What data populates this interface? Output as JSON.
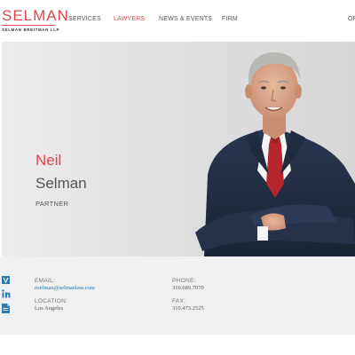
{
  "brand": {
    "name": "SELMAN",
    "subname": "SELMAN BREITMAN LLP",
    "accent_color": "#e0474c"
  },
  "nav": {
    "items": [
      {
        "label": "SERVICES",
        "active": false
      },
      {
        "label": "LAWYERS",
        "active": true
      },
      {
        "label": "NEWS & EVENTS",
        "active": false
      },
      {
        "label": "FIRM",
        "active": false
      },
      {
        "label": "OF",
        "active": false
      }
    ]
  },
  "profile": {
    "first_name": "Neil",
    "last_name": "Selman",
    "title": "PARTNER"
  },
  "contact": {
    "email_label": "EMAIL:",
    "email": "nselman@selmanlaw.com",
    "location_label": "LOCATION:",
    "location": "Los Angeles",
    "phone_label": "PHONE:",
    "phone": "310.689.7070",
    "fax_label": "FAX:",
    "fax": "310.473.2525"
  },
  "icons": {
    "vcard": "vcard-icon",
    "linkedin": "linkedin-icon",
    "pdf": "pdf-icon",
    "icon_color": "#2a7ab0"
  }
}
